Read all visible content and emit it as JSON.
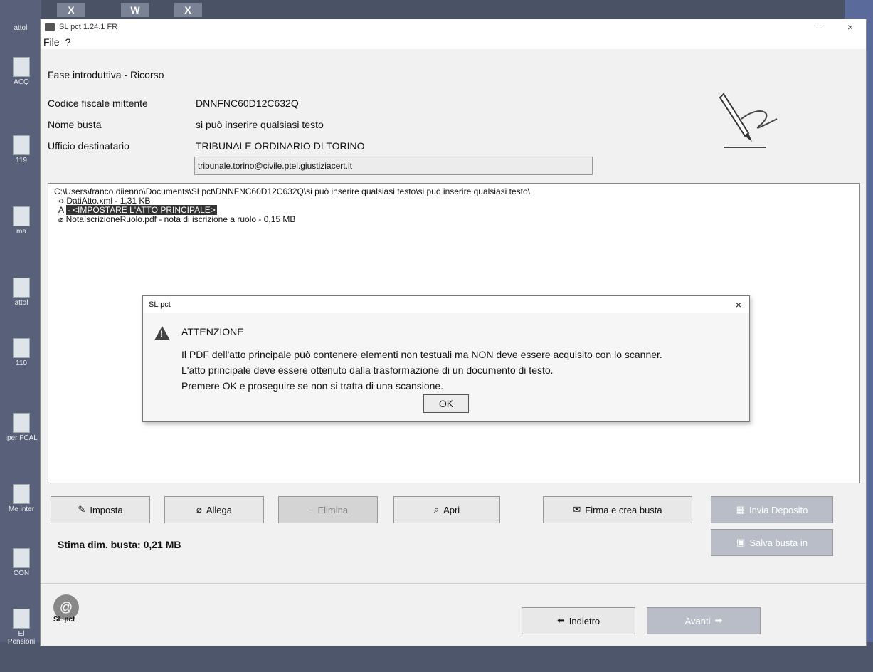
{
  "taskbar": {
    "icons": [
      "X",
      "W",
      "X"
    ]
  },
  "desktop": {
    "icons": [
      "attoli",
      "ACQ",
      "119",
      "ma",
      "attol",
      "110",
      "Iper FCAL",
      "Me inter",
      "CON",
      "El Pensioni"
    ]
  },
  "window": {
    "title": "SL pct 1.24.1 FR",
    "minimize": "–",
    "close": "×",
    "menu": [
      "File",
      "?"
    ]
  },
  "phase": {
    "title": "Fase introduttiva - Ricorso"
  },
  "form": {
    "sender_label": "Codice fiscale mittente",
    "sender_value": "DNNFNC60D12C632Q",
    "envelope_label": "Nome busta",
    "envelope_value": "si può inserire qualsiasi testo",
    "office_label": "Ufficio destinatario",
    "office_value": "TRIBUNALE ORDINARIO DI TORINO",
    "email": "tribunale.torino@civile.ptel.giustiziacert.it"
  },
  "tree": {
    "root": "C:\\Users\\franco.diienno\\Documents\\SLpct\\DNNFNC60D12C632Q\\si può inserire qualsiasi testo\\si può inserire qualsiasi testo\\",
    "items": [
      {
        "prefix": "‹›",
        "label": "DatiAtto.xml - 1,31 KB"
      },
      {
        "prefix": "A",
        "label": "- <IMPOSTARE L'ATTO PRINCIPALE>"
      },
      {
        "prefix": "⌀",
        "label": "NotaIscrizioneRuolo.pdf - nota di iscrizione a ruolo - 0,15 MB"
      }
    ]
  },
  "dialog": {
    "title": "SL pct",
    "heading": "ATTENZIONE",
    "line1": "Il PDF dell'atto principale può contenere elementi non testuali ma NON deve essere acquisito con lo scanner.",
    "line2": "L'atto principale deve essere ottenuto dalla trasformazione di un documento di testo.",
    "line3": "Premere OK e proseguire se non si tratta di una scansione.",
    "ok": "OK",
    "close": "×"
  },
  "buttons": {
    "imposta": "Imposta",
    "allega": "Allega",
    "elimina": "Elimina",
    "apri": "Apri",
    "firma": "Firma e crea busta",
    "invia": "Invia Deposito",
    "salva": "Salva busta in",
    "indietro": "Indietro",
    "avanti": "Avanti"
  },
  "estimate": "Stima dim. busta: 0,21 MB",
  "footer": {
    "logo_label": "SL pct"
  }
}
